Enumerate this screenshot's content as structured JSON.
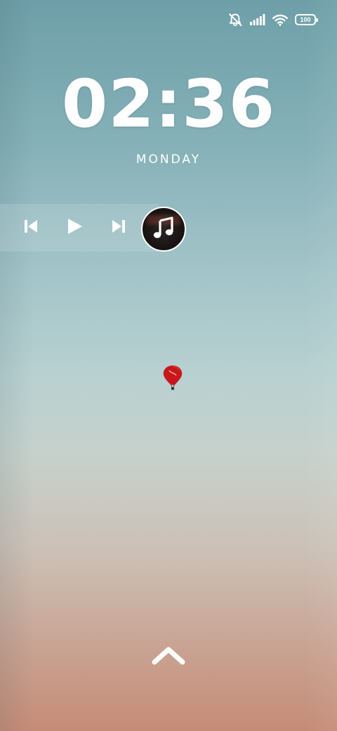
{
  "status_bar": {
    "icons": [
      "muted-bell-icon",
      "signal-icon",
      "wifi-icon",
      "battery-icon"
    ],
    "battery_level": "100"
  },
  "lock_screen": {
    "time": "02:36",
    "day": "MONDAY"
  },
  "media_controls": {
    "icons": [
      "previous-track-icon",
      "play-icon",
      "next-track-icon",
      "music-note-icon"
    ]
  },
  "wallpaper": {
    "subject": "hot-air-balloon-icon",
    "colors": {
      "sky_top": "#6e9fa8",
      "sky_middle": "#b9d1d1",
      "sky_bottom": "#c58c76",
      "balloon": "#c8161b"
    }
  },
  "swipe_hint": {
    "icon": "chevron-up-icon"
  }
}
